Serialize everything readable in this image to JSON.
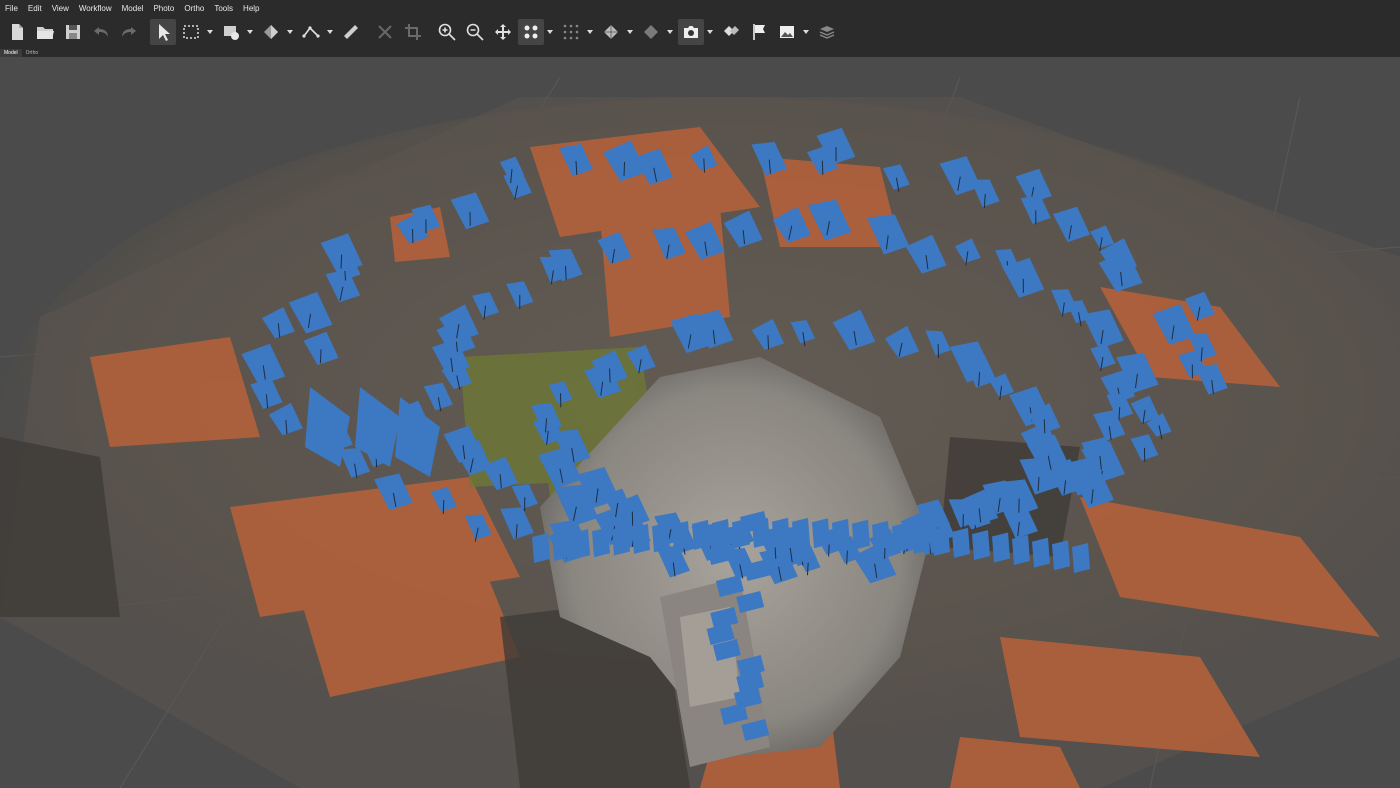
{
  "menu": {
    "items": [
      "File",
      "Edit",
      "View",
      "Workflow",
      "Model",
      "Photo",
      "Ortho",
      "Tools",
      "Help"
    ]
  },
  "toolbar": {
    "buttons": [
      {
        "icon": "new-document-icon"
      },
      {
        "icon": "open-folder-icon"
      },
      {
        "icon": "save-icon"
      },
      {
        "icon": "undo-icon"
      },
      {
        "icon": "redo-icon"
      },
      {
        "icon": "navigation-arrow-icon"
      },
      {
        "icon": "rectangle-selection-icon"
      },
      {
        "icon": "shape-draw-icon"
      },
      {
        "icon": "transform-object-icon"
      },
      {
        "icon": "ruler-polyline-icon"
      },
      {
        "icon": "ruler-icon"
      },
      {
        "icon": "delete-selection-icon"
      },
      {
        "icon": "crop-selection-icon"
      },
      {
        "icon": "zoom-in-icon"
      },
      {
        "icon": "zoom-out-icon"
      },
      {
        "icon": "move-object-icon"
      },
      {
        "icon": "point-cloud-icon"
      },
      {
        "icon": "grid-dots-icon"
      },
      {
        "icon": "mesh-model-icon"
      },
      {
        "icon": "solid-model-icon"
      },
      {
        "icon": "camera-icon"
      },
      {
        "icon": "markers-icon"
      },
      {
        "icon": "flag-icon"
      },
      {
        "icon": "image-icon"
      },
      {
        "icon": "layers-icon"
      }
    ]
  },
  "tabs": [
    {
      "label": "Model",
      "active": true
    },
    {
      "label": "Ortho",
      "active": false
    }
  ],
  "colors": {
    "background": "#4b4b4b",
    "toolbar": "#2b2b2b",
    "camera_planes": "#3d78c2",
    "roof": "#b8623a"
  }
}
